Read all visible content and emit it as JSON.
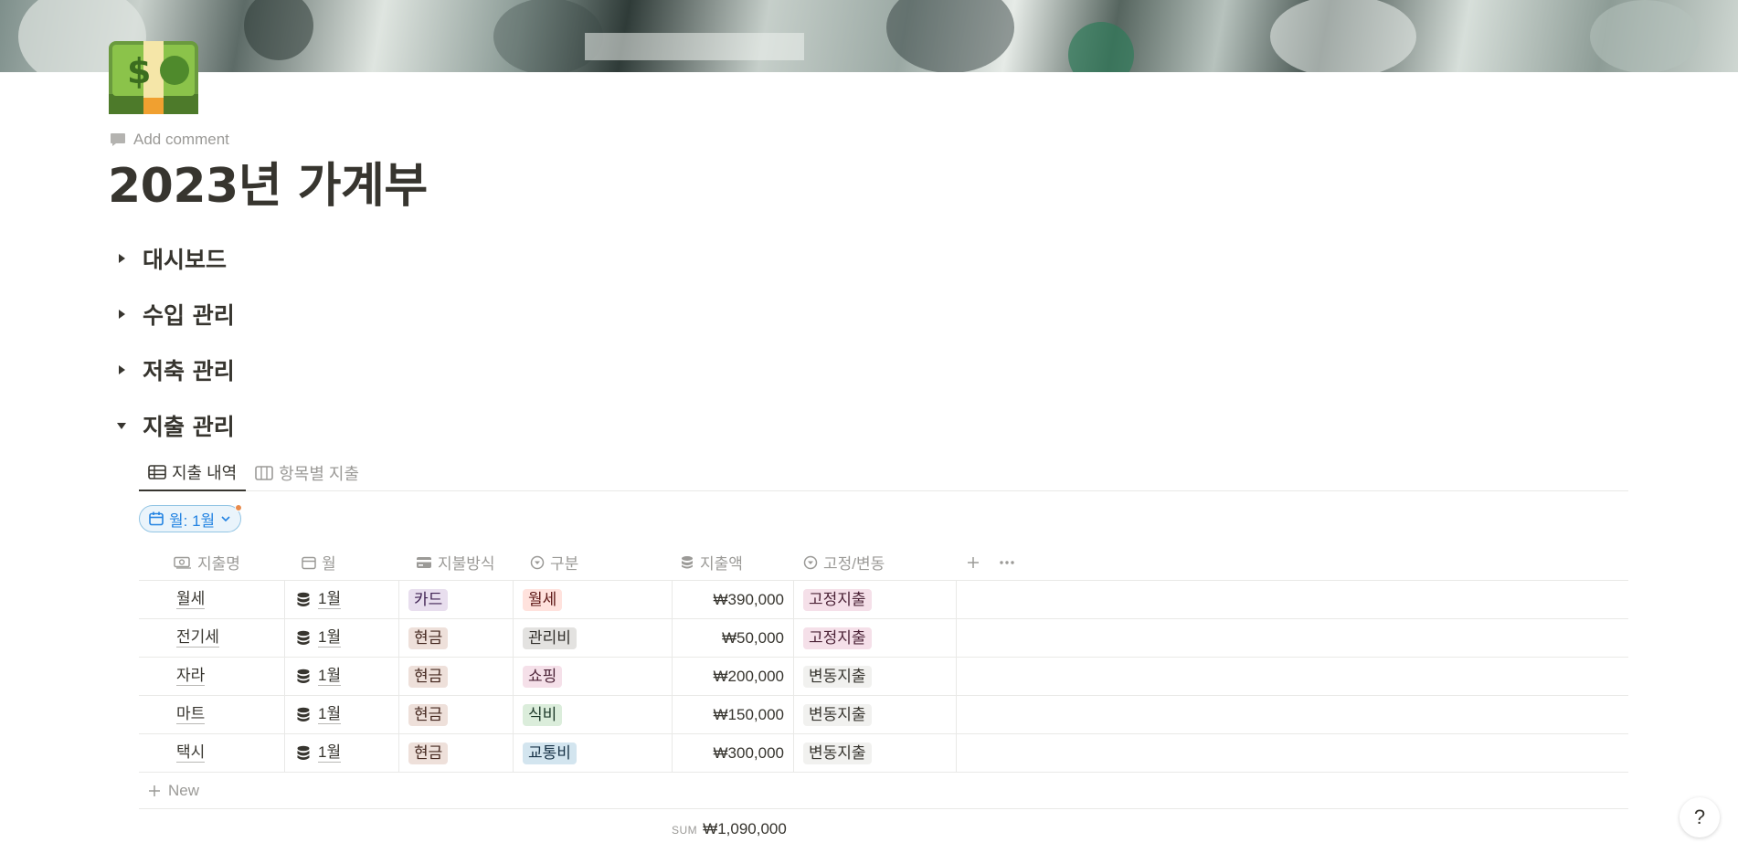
{
  "cover": {
    "alt_icon": "dollar-bills-cover"
  },
  "page": {
    "icon": "money-bill-icon",
    "add_comment": "Add comment",
    "title": "2023년 가계부"
  },
  "toggles": [
    {
      "label": "대시보드",
      "open": false
    },
    {
      "label": "수입 관리",
      "open": false
    },
    {
      "label": "저축 관리",
      "open": false
    },
    {
      "label": "지출 관리",
      "open": true
    }
  ],
  "views": {
    "tabs": [
      {
        "label": "지출 내역",
        "icon": "table-icon",
        "active": true
      },
      {
        "label": "항목별 지출",
        "icon": "board-icon",
        "active": false
      }
    ],
    "filter": {
      "label": "월: 1월"
    }
  },
  "table": {
    "headers": [
      "지출명",
      "월",
      "지불방식",
      "구분",
      "지출액",
      "고정/변동"
    ],
    "rows": [
      {
        "name": "월세",
        "month": "1월",
        "method": "카드",
        "category": "월세",
        "amount": "₩390,000",
        "type": "고정지출"
      },
      {
        "name": "전기세",
        "month": "1월",
        "method": "현금",
        "category": "관리비",
        "amount": "₩50,000",
        "type": "고정지출"
      },
      {
        "name": "자라",
        "month": "1월",
        "method": "현금",
        "category": "쇼핑",
        "amount": "₩200,000",
        "type": "변동지출"
      },
      {
        "name": "마트",
        "month": "1월",
        "method": "현금",
        "category": "식비",
        "amount": "₩150,000",
        "type": "변동지출"
      },
      {
        "name": "택시",
        "month": "1월",
        "method": "현금",
        "category": "교통비",
        "amount": "₩300,000",
        "type": "변동지출"
      }
    ],
    "new_label": "New",
    "sum_key": "SUM",
    "sum_value": "₩1,090,000"
  },
  "tag_colors": {
    "카드": {
      "bg": "#e8deee",
      "fg": "#412454"
    },
    "현금": {
      "bg": "#eee0da",
      "fg": "#44271f"
    },
    "월세": {
      "bg": "#ffe2dd",
      "fg": "#5d1715"
    },
    "관리비": {
      "bg": "#e3e2e0",
      "fg": "#32302c"
    },
    "쇼핑": {
      "bg": "#f5e0e9",
      "fg": "#4c2337"
    },
    "식비": {
      "bg": "#dbeddb",
      "fg": "#1c3829"
    },
    "교통비": {
      "bg": "#d3e5ef",
      "fg": "#183347"
    },
    "고정지출": {
      "bg": "#f5e0e9",
      "fg": "#4c2337"
    },
    "변동지출": {
      "bg": "#f1f1ef",
      "fg": "#37352f"
    }
  },
  "help": {
    "label": "?"
  }
}
